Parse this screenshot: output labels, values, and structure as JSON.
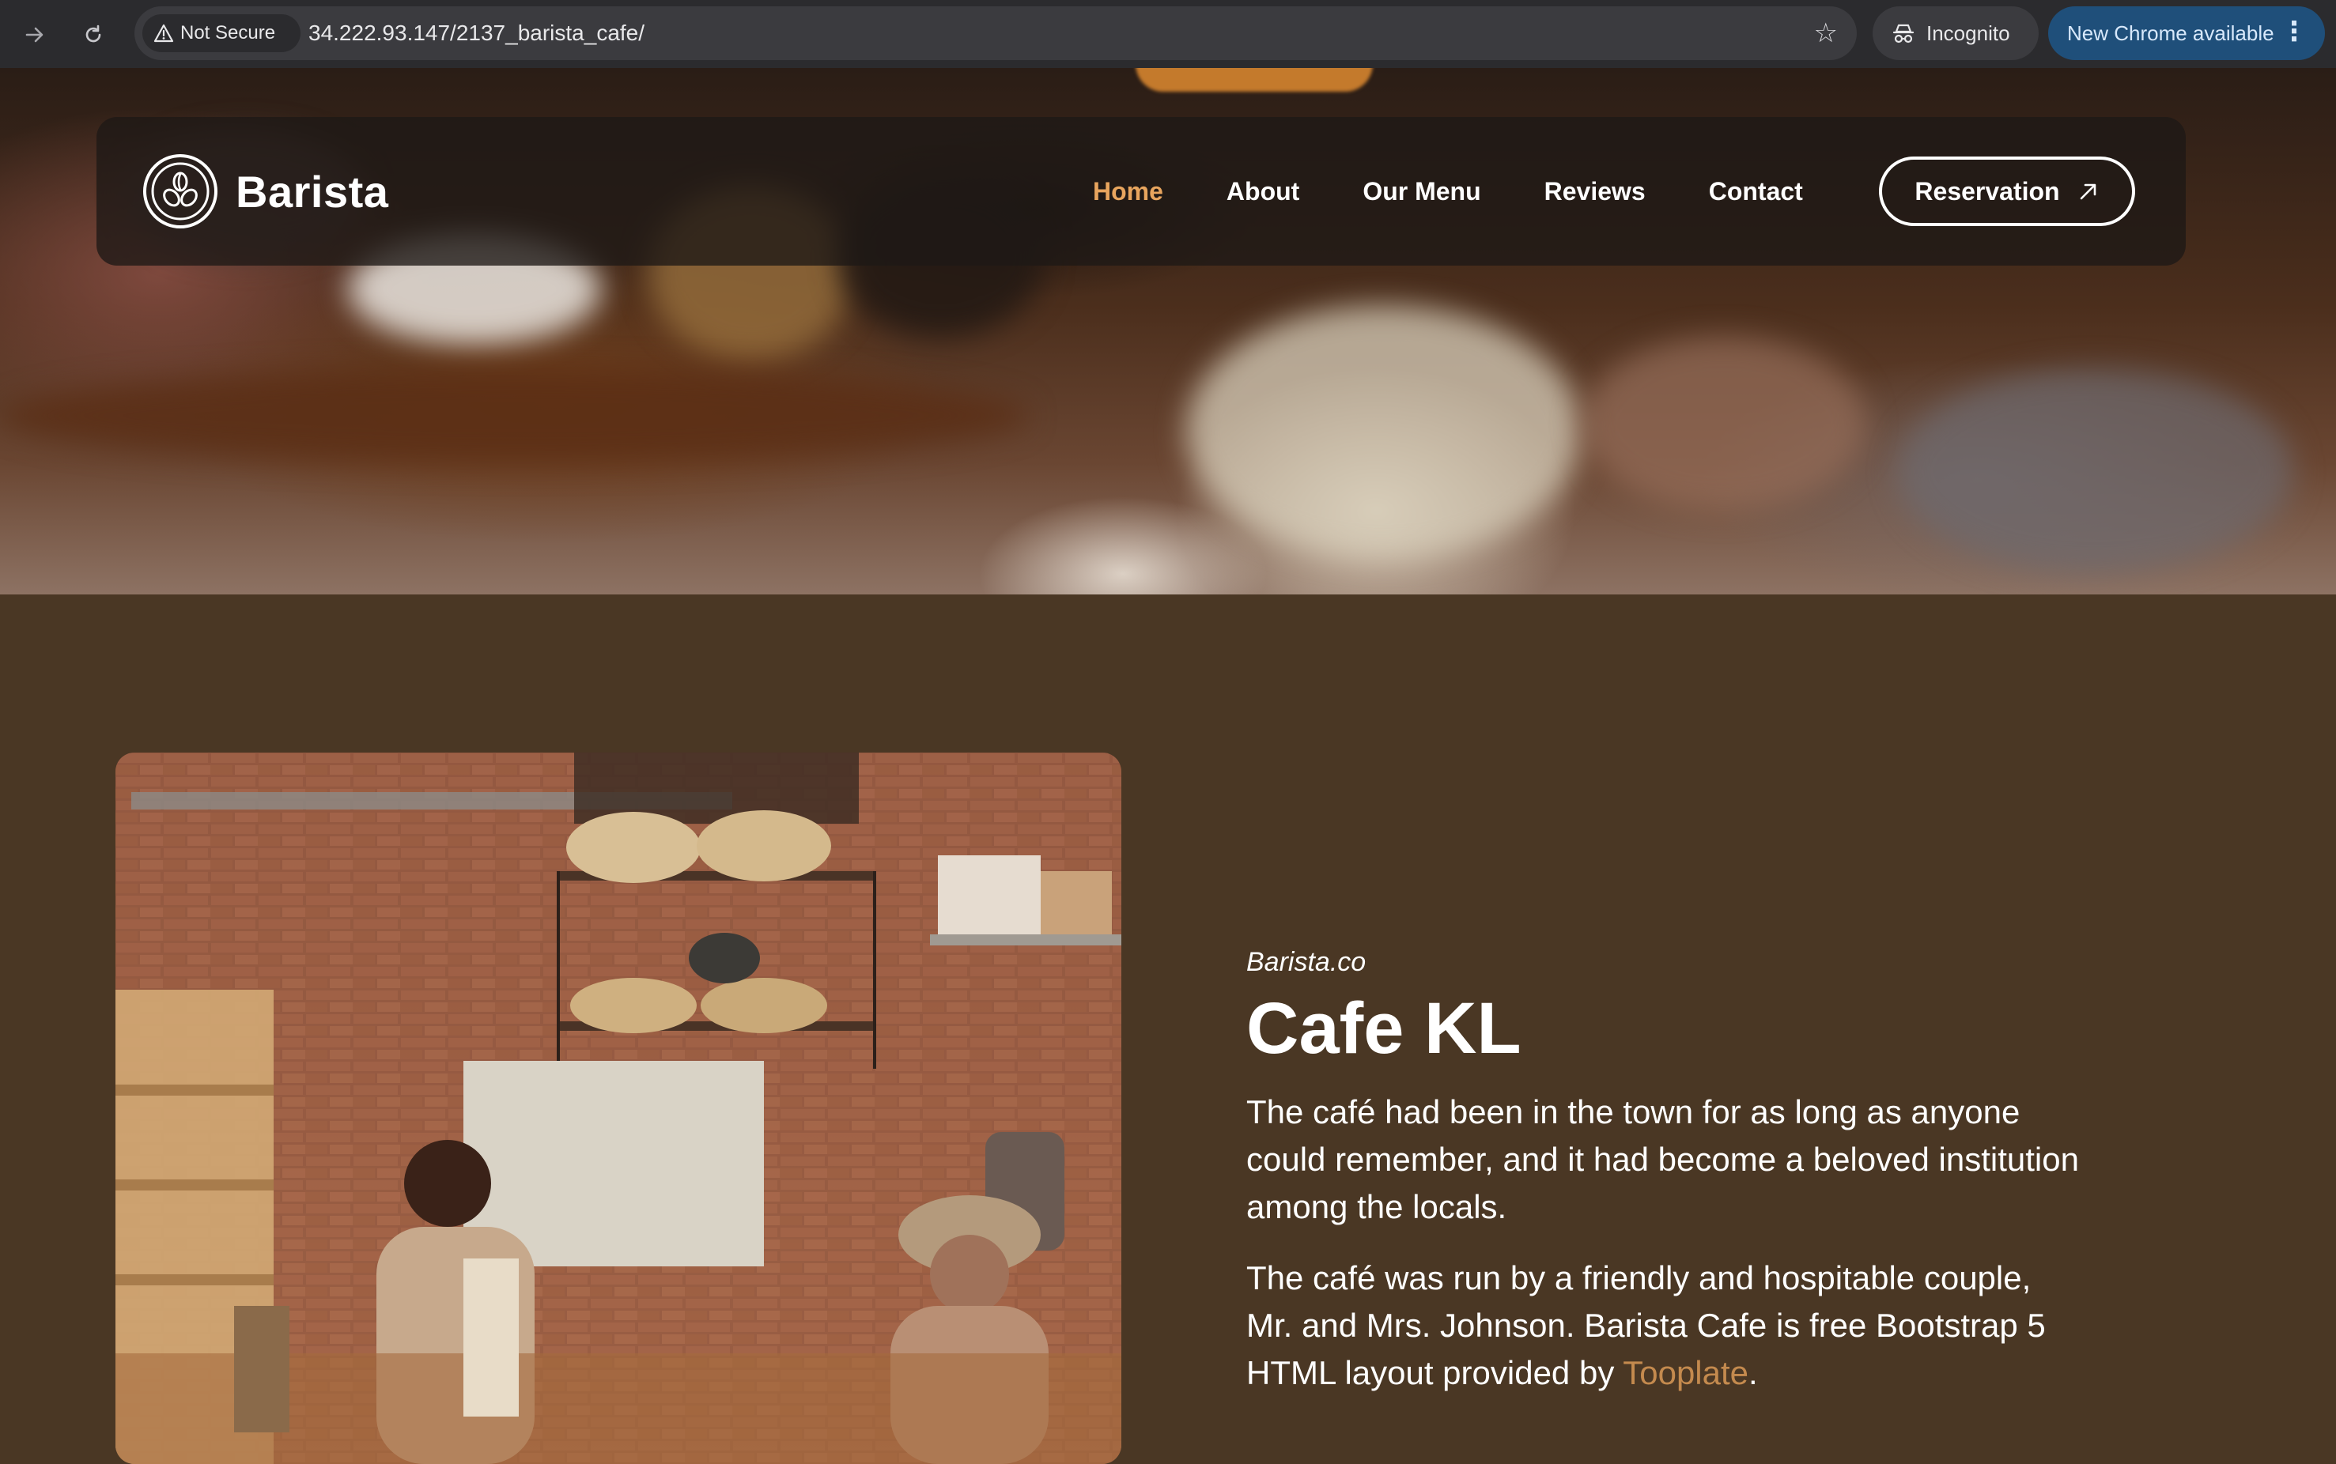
{
  "browser": {
    "security_label": "Not Secure",
    "url": "34.222.93.147/2137_barista_cafe/",
    "incognito_label": "Incognito",
    "update_label": "New Chrome available"
  },
  "navbar": {
    "brand": "Barista",
    "links": [
      {
        "label": "Home",
        "active": true
      },
      {
        "label": "About",
        "active": false
      },
      {
        "label": "Our Menu",
        "active": false
      },
      {
        "label": "Reviews",
        "active": false
      },
      {
        "label": "Contact",
        "active": false
      }
    ],
    "reservation_label": "Reservation",
    "accent": "#e8a55e"
  },
  "about": {
    "subtitle": "Barista.co",
    "title": "Cafe KL",
    "paragraph1": "The café had been in the town for as long as anyone could remember, and it had become a beloved institution among the locals.",
    "paragraph2_prefix": "The café was run by a friendly and hospitable couple, Mr. and Mrs. Johnson. Barista Cafe is free Bootstrap 5 HTML layout provided by ",
    "paragraph2_link": "Tooplate",
    "paragraph2_suffix": ".",
    "link_color": "#c48a4e",
    "background": "#4a3724"
  }
}
